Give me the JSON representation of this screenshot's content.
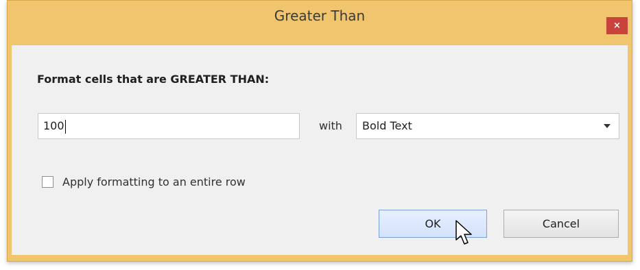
{
  "window": {
    "title": "Greater Than",
    "close_label": "×"
  },
  "form": {
    "heading": "Format cells that are GREATER THAN:",
    "value": "100",
    "with_label": "with",
    "format_selected": "Bold Text",
    "checkbox_label": "Apply formatting to an entire row",
    "checkbox_checked": false
  },
  "buttons": {
    "ok_label": "OK",
    "cancel_label": "Cancel"
  },
  "colors": {
    "titlebar": "#f0c56e",
    "close": "#c8433b",
    "ok_highlight": "#d2e2fb"
  },
  "icons": {
    "close": "close-icon",
    "dropdown": "chevron-down-icon",
    "cursor": "mouse-pointer-icon"
  }
}
